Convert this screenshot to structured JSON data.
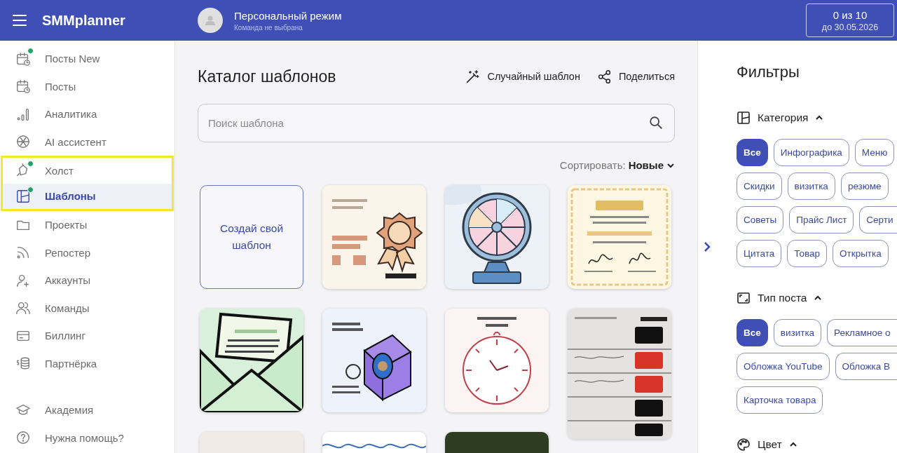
{
  "app": {
    "name": "SMMplanner"
  },
  "header": {
    "mode": "Персональный режим",
    "team": "Команда не выбрана",
    "quota": "0 из 10",
    "until": "до 30.05.2026"
  },
  "sidebar": {
    "items": [
      {
        "label": "Посты New",
        "selected": false,
        "dot": true,
        "highlighted": false
      },
      {
        "label": "Посты",
        "selected": false,
        "dot": false,
        "highlighted": false
      },
      {
        "label": "Аналитика",
        "selected": false,
        "dot": false,
        "highlighted": false
      },
      {
        "label": "AI ассистент",
        "selected": false,
        "dot": false,
        "highlighted": false
      },
      {
        "label": "Холст",
        "selected": false,
        "dot": true,
        "highlighted": true
      },
      {
        "label": "Шаблоны",
        "selected": true,
        "dot": true,
        "highlighted": true
      },
      {
        "label": "Проекты",
        "selected": false,
        "dot": false,
        "highlighted": false
      },
      {
        "label": "Репостер",
        "selected": false,
        "dot": false,
        "highlighted": false
      },
      {
        "label": "Аккаунты",
        "selected": false,
        "dot": false,
        "highlighted": false
      },
      {
        "label": "Команды",
        "selected": false,
        "dot": false,
        "highlighted": false
      },
      {
        "label": "Биллинг",
        "selected": false,
        "dot": false,
        "highlighted": false
      },
      {
        "label": "Партнёрка",
        "selected": false,
        "dot": false,
        "highlighted": false
      }
    ],
    "footer_items": [
      {
        "label": "Академия"
      },
      {
        "label": "Нужна помощь?"
      }
    ]
  },
  "catalog": {
    "title": "Каталог шаблонов",
    "actions": [
      "Случайный шаблон",
      "Поделиться"
    ],
    "search": {
      "placeholder": "Поиск шаблона"
    },
    "sort": {
      "label": "Сортировать:",
      "value": "Новые"
    },
    "columns": [
      [
        {
          "kind": "create",
          "label": "Создай свой шаблон"
        },
        {
          "kind": "square"
        },
        {
          "kind": "square"
        }
      ],
      [
        {
          "kind": "square"
        },
        {
          "kind": "square"
        },
        {
          "kind": "square"
        }
      ],
      [
        {
          "kind": "square"
        },
        {
          "kind": "square"
        },
        {
          "kind": "square"
        }
      ],
      [
        {
          "kind": "square"
        },
        {
          "kind": "tall"
        }
      ]
    ]
  },
  "filters": {
    "title": "Фильтры",
    "sections": [
      {
        "title": "Категория",
        "expanded": true,
        "chips": [
          {
            "label": "Все",
            "selected": true,
            "cut": false
          },
          {
            "label": "Инфографика",
            "selected": false,
            "cut": false
          },
          {
            "label": "Меню",
            "selected": false,
            "cut": false
          },
          {
            "label": "Скидки",
            "selected": false,
            "cut": false
          },
          {
            "label": "визитка",
            "selected": false,
            "cut": false
          },
          {
            "label": "резюме",
            "selected": false,
            "cut": false
          },
          {
            "label": "Советы",
            "selected": false,
            "cut": false
          },
          {
            "label": "Прайс Лист",
            "selected": false,
            "cut": false
          },
          {
            "label": "Серти",
            "selected": false,
            "cut": true
          },
          {
            "label": "Цитата",
            "selected": false,
            "cut": false
          },
          {
            "label": "Товар",
            "selected": false,
            "cut": false
          },
          {
            "label": "Открытка",
            "selected": false,
            "cut": false
          }
        ]
      },
      {
        "title": "Тип поста",
        "expanded": true,
        "chips": [
          {
            "label": "Все",
            "selected": true,
            "cut": false
          },
          {
            "label": "визитка",
            "selected": false,
            "cut": false
          },
          {
            "label": "Рекламное о",
            "selected": false,
            "cut": true
          },
          {
            "label": "Обложка YouTube",
            "selected": false,
            "cut": false
          },
          {
            "label": "Обложка В",
            "selected": false,
            "cut": true
          },
          {
            "label": "Карточка товара",
            "selected": false,
            "cut": false
          }
        ]
      },
      {
        "title": "Цвет",
        "expanded": true
      }
    ]
  }
}
